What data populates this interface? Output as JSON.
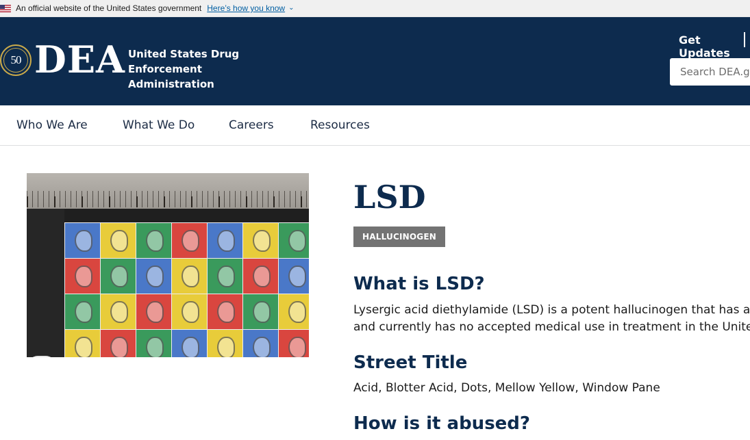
{
  "gov_banner": {
    "text": "An official website of the United States government",
    "link": "Here’s how you know"
  },
  "header": {
    "seal_text": "50",
    "logo_text": "DEA",
    "agency_line1": "United States Drug Enforcement",
    "agency_line2": "Administration",
    "get_updates": "Get Updates",
    "search_placeholder": "Search DEA.gov"
  },
  "nav": {
    "items": [
      "Who We Are",
      "What We Do",
      "Careers",
      "Resources"
    ]
  },
  "main": {
    "title": "LSD",
    "category_tag": "HALLUCINOGEN",
    "sections": [
      {
        "heading": "What is LSD?",
        "lines": [
          "Lysergic acid diethylamide (LSD) is a potent hallucinogen that has a hi",
          "and currently has no accepted medical use in treatment in the United S"
        ]
      },
      {
        "heading": "Street Title",
        "lines": [
          "Acid, Blotter Acid, Dots, Mellow Yellow, Window Pane"
        ]
      },
      {
        "heading": "How is it abused?",
        "lines": []
      }
    ]
  },
  "colors": {
    "header_bg": "#0d2b4e",
    "tag_bg": "#737373",
    "link": "#005ea2",
    "seal_gold": "#c9a94a"
  }
}
